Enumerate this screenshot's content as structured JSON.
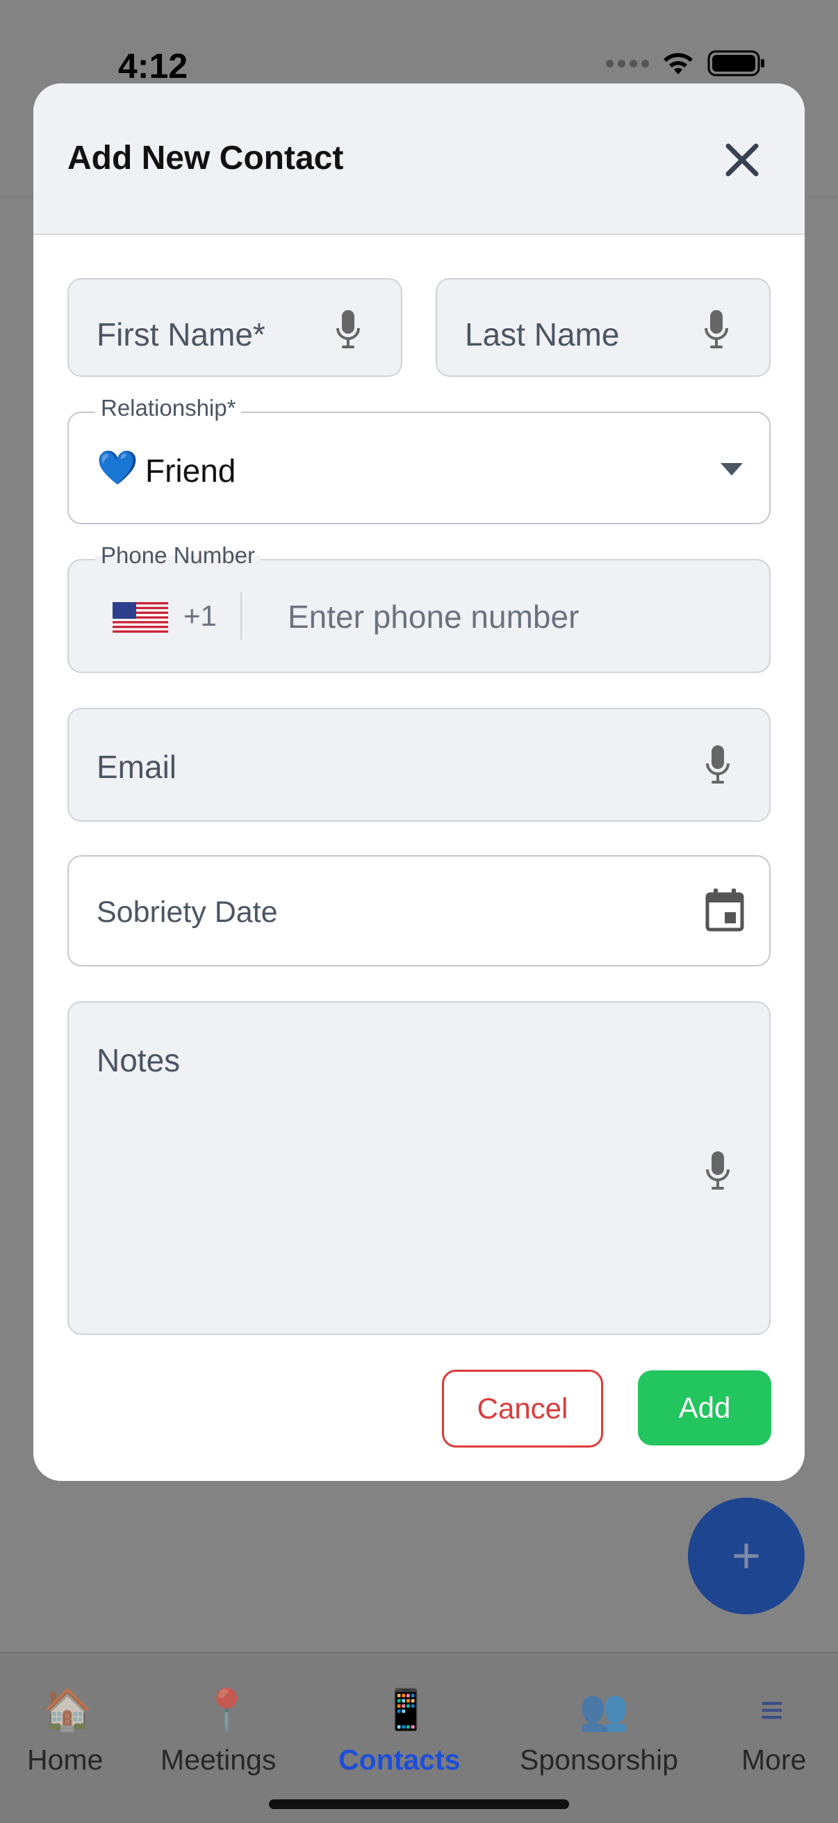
{
  "status_bar": {
    "time": "4:12"
  },
  "modal": {
    "title": "Add New Contact",
    "fields": {
      "first_name": {
        "placeholder": "First Name*"
      },
      "last_name": {
        "placeholder": "Last Name"
      },
      "relationship": {
        "label": "Relationship*",
        "value_emoji": "💙",
        "value": "Friend"
      },
      "phone": {
        "label": "Phone Number",
        "country_flag": "us-flag-icon",
        "country_code": "+1",
        "placeholder": "Enter phone number"
      },
      "email": {
        "placeholder": "Email"
      },
      "sobriety_date": {
        "placeholder": "Sobriety Date"
      },
      "notes": {
        "placeholder": "Notes"
      }
    },
    "buttons": {
      "cancel": "Cancel",
      "add": "Add"
    }
  },
  "fab": {
    "label": "+"
  },
  "tabbar": {
    "items": [
      {
        "label": "Home",
        "icon": "🏠",
        "active": false
      },
      {
        "label": "Meetings",
        "icon": "📍",
        "active": false
      },
      {
        "label": "Contacts",
        "icon": "📱",
        "active": true
      },
      {
        "label": "Sponsorship",
        "icon": "👥",
        "active": false
      },
      {
        "label": "More",
        "icon": "≡",
        "active": false
      }
    ]
  },
  "colors": {
    "accent_green": "#22c55e",
    "cancel_red": "#dc3b3b",
    "active_tab": "#1d4ed8",
    "fab": "#1e4590"
  }
}
